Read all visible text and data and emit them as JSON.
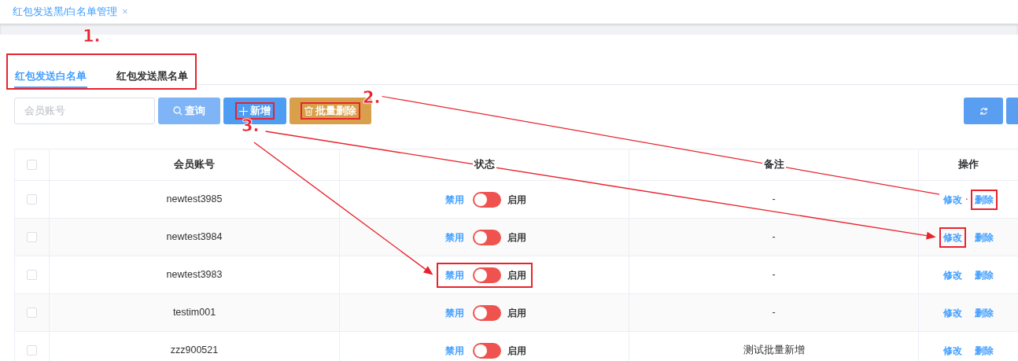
{
  "page_tab": {
    "title": "红包发送黑/白名单管理",
    "close": "×"
  },
  "tabs": [
    {
      "label": "红包发送白名单",
      "selected": true
    },
    {
      "label": "红包发送黑名单",
      "selected": false
    }
  ],
  "search": {
    "placeholder": "会员账号"
  },
  "buttons": [
    {
      "kind": "search",
      "label": "查询",
      "highlighted": false
    },
    {
      "kind": "add",
      "label": "新增",
      "highlighted": true
    },
    {
      "kind": "delete",
      "label": "批量删除",
      "highlighted": true
    }
  ],
  "table": {
    "select_all": {
      "checked": false
    },
    "columns": [
      "会员账号",
      "状态",
      "备注",
      "操作"
    ],
    "rows": [
      {
        "checked": false,
        "account": "newtest3985",
        "off_label": "禁用",
        "on": false,
        "on_label": "启用",
        "note": "-",
        "edit": "修改",
        "delete": "删除",
        "status_highlighted": false,
        "edit_highlighted": false,
        "delete_highlighted": true
      },
      {
        "checked": false,
        "account": "newtest3984",
        "off_label": "禁用",
        "on": false,
        "on_label": "启用",
        "note": "-",
        "edit": "修改",
        "delete": "删除",
        "status_highlighted": false,
        "edit_highlighted": true,
        "delete_highlighted": false
      },
      {
        "checked": false,
        "account": "newtest3983",
        "off_label": "禁用",
        "on": false,
        "on_label": "启用",
        "note": "-",
        "edit": "修改",
        "delete": "删除",
        "status_highlighted": true,
        "edit_highlighted": false,
        "delete_highlighted": false
      },
      {
        "checked": false,
        "account": "testim001",
        "off_label": "禁用",
        "on": false,
        "on_label": "启用",
        "note": "-",
        "edit": "修改",
        "delete": "删除",
        "status_highlighted": false,
        "edit_highlighted": false,
        "delete_highlighted": false
      },
      {
        "checked": false,
        "account": "zzz900521",
        "off_label": "禁用",
        "on": false,
        "on_label": "启用",
        "note": "测试批量新增",
        "edit": "修改",
        "delete": "删除",
        "status_highlighted": false,
        "edit_highlighted": false,
        "delete_highlighted": false
      }
    ]
  },
  "annotations": [
    {
      "label": "1."
    },
    {
      "label": "2."
    },
    {
      "label": "3."
    }
  ]
}
